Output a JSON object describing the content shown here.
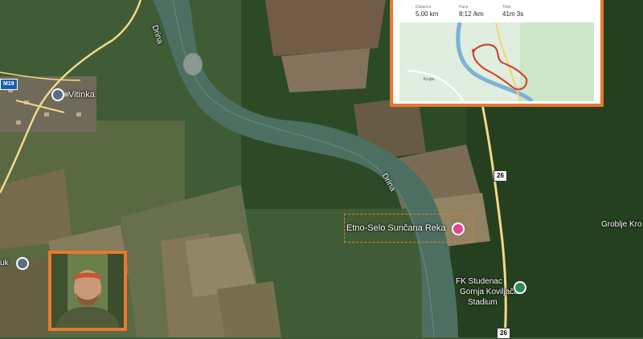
{
  "map": {
    "river_name": "Drina",
    "places": {
      "vitinka": "Vitinka",
      "etno_selo": "Etno-Selo Sunčana Reka",
      "groblje": "Groblje Kro",
      "fk_line1": "FK Studenac",
      "fk_line2": "Gornja Koviljača",
      "fk_line3": "Stadium",
      "left_edge": "uk"
    },
    "road_shields": {
      "m419": "M19",
      "r26_mid": "26",
      "r26_bottom": "26"
    },
    "colors": {
      "accent_border": "#e8792e",
      "poi_pink": "#e0459c",
      "route_red": "#d6361f"
    }
  },
  "inset": {
    "stats": [
      {
        "label": "Distance",
        "value": "5.00 km"
      },
      {
        "label": "Pace",
        "value": "8:12 /km"
      },
      {
        "label": "Time",
        "value": "41m 3s"
      }
    ],
    "town": "Krupa"
  }
}
